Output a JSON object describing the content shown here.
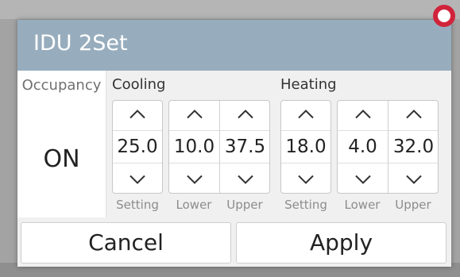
{
  "dialog": {
    "title": "IDU 2Set"
  },
  "occupancy": {
    "label": "Occupancy",
    "value": "ON"
  },
  "cooling": {
    "label": "Cooling",
    "setting": {
      "value": "25.0",
      "label": "Setting"
    },
    "lower": {
      "value": "10.0",
      "label": "Lower"
    },
    "upper": {
      "value": "37.5",
      "label": "Upper"
    }
  },
  "heating": {
    "label": "Heating",
    "setting": {
      "value": "18.0",
      "label": "Setting"
    },
    "lower": {
      "value": "4.0",
      "label": "Lower"
    },
    "upper": {
      "value": "32.0",
      "label": "Upper"
    }
  },
  "buttons": {
    "cancel": "Cancel",
    "apply": "Apply"
  },
  "icons": {
    "up": "chevron-up-icon",
    "down": "chevron-down-icon",
    "corner_badge": "ring-icon"
  },
  "colors": {
    "title_bar": "#97adbe",
    "badge": "#d0243b"
  }
}
